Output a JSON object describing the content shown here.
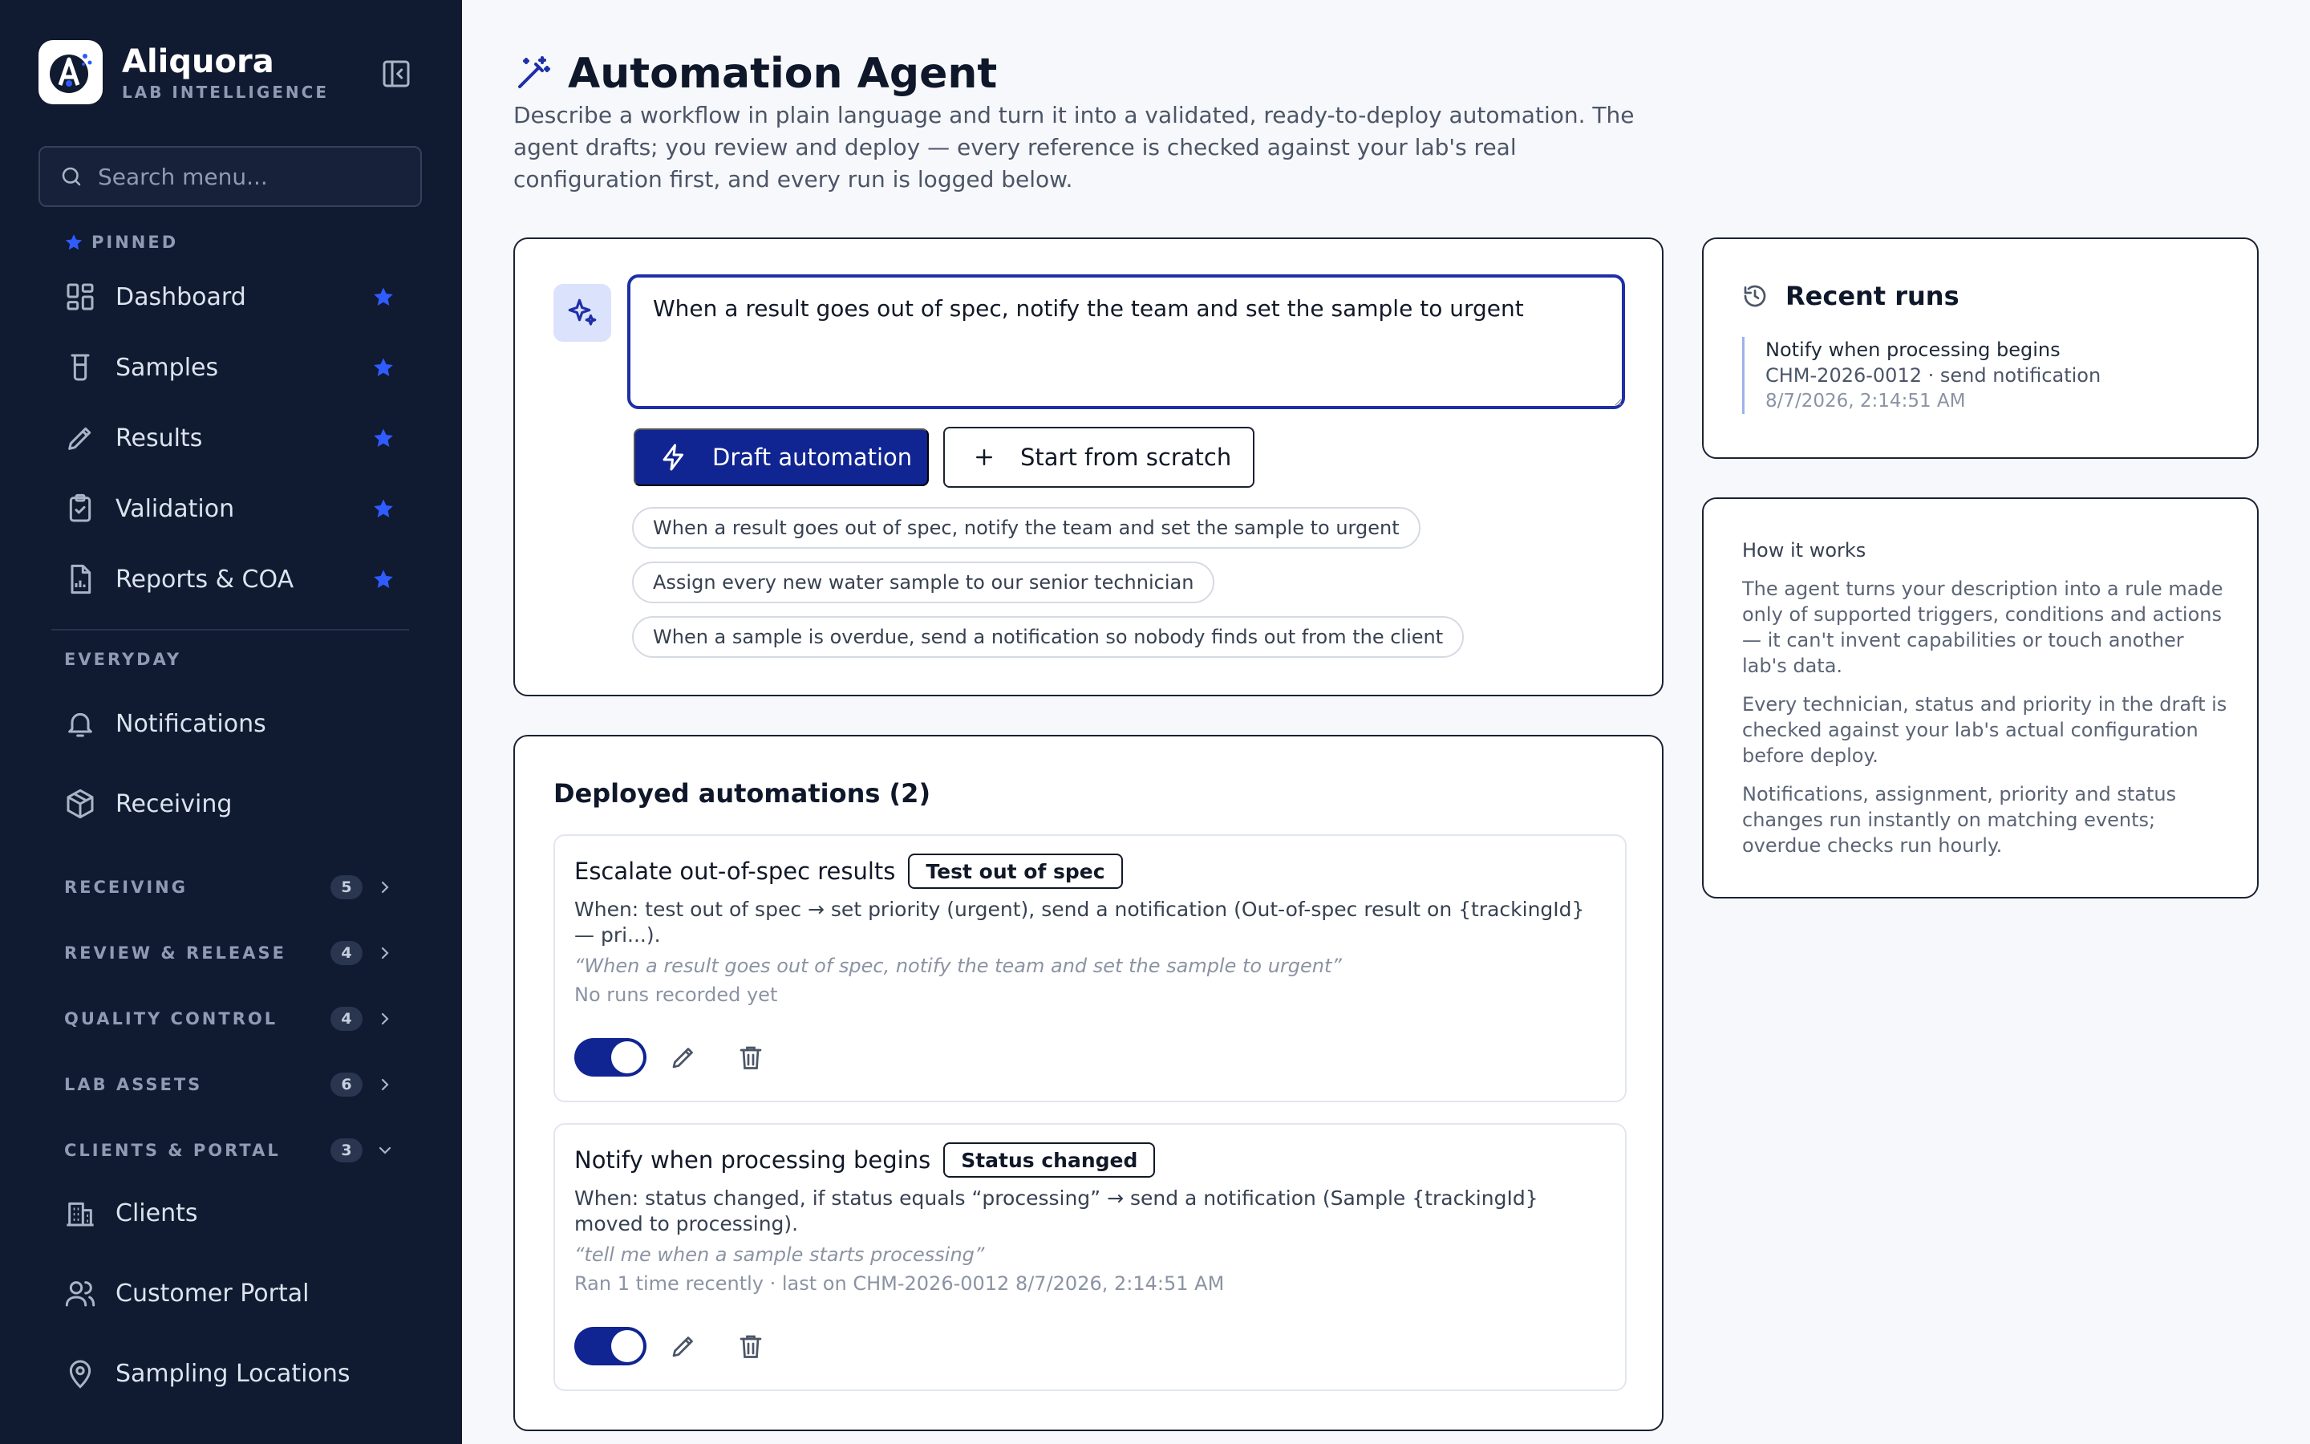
{
  "brand": {
    "name": "Aliquora",
    "subtitle": "LAB INTELLIGENCE"
  },
  "sidebar": {
    "search_placeholder": "Search menu...",
    "pinned_label": "PINNED",
    "pinned_items": [
      {
        "label": "Dashboard",
        "icon": "dashboard-icon"
      },
      {
        "label": "Samples",
        "icon": "beaker-icon"
      },
      {
        "label": "Results",
        "icon": "pencil-icon"
      },
      {
        "label": "Validation",
        "icon": "clipboard-check-icon"
      },
      {
        "label": "Reports & COA",
        "icon": "report-icon"
      }
    ],
    "everyday_label": "EVERYDAY",
    "everyday_items": [
      {
        "label": "Notifications",
        "icon": "bell-icon"
      },
      {
        "label": "Receiving",
        "icon": "package-icon"
      }
    ],
    "groups": [
      {
        "label": "RECEIVING",
        "count": "5",
        "expanded": false
      },
      {
        "label": "REVIEW & RELEASE",
        "count": "4",
        "expanded": false
      },
      {
        "label": "QUALITY CONTROL",
        "count": "4",
        "expanded": false
      },
      {
        "label": "LAB ASSETS",
        "count": "6",
        "expanded": false
      },
      {
        "label": "CLIENTS & PORTAL",
        "count": "3",
        "expanded": true
      }
    ],
    "client_items": [
      {
        "label": "Clients",
        "icon": "building-icon"
      },
      {
        "label": "Customer Portal",
        "icon": "users-icon"
      },
      {
        "label": "Sampling Locations",
        "icon": "map-pin-icon"
      }
    ]
  },
  "page": {
    "title": "Automation Agent",
    "description": "Describe a workflow in plain language and turn it into a validated, ready-to-deploy automation. The agent drafts; you review and deploy — every reference is checked against your lab's real configuration first, and every run is logged below."
  },
  "composer": {
    "prompt_value": "When a result goes out of spec, notify the team and set the sample to urgent",
    "draft_label": "Draft automation",
    "scratch_label": "Start from scratch",
    "suggestions": [
      "When a result goes out of spec, notify the team and set the sample to urgent",
      "Assign every new water sample to our senior technician",
      "When a sample is overdue, send a notification so nobody finds out from the client"
    ]
  },
  "deployed": {
    "heading": "Deployed automations (2)",
    "items": [
      {
        "name": "Escalate out-of-spec results",
        "trigger": "Test out of spec",
        "when": "When: test out of spec → set priority (urgent), send a notification (Out-of-spec result on {trackingId} — pri...).",
        "quote": "“When a result goes out of spec, notify the team and set the sample to urgent”",
        "meta": "No runs recorded yet",
        "enabled": true
      },
      {
        "name": "Notify when processing begins",
        "trigger": "Status changed",
        "when": "When: status changed, if status equals “processing” → send a notification (Sample {trackingId} moved to processing).",
        "quote": "“tell me when a sample starts processing”",
        "meta": "Ran 1 time recently · last on CHM-2026-0012 8/7/2026, 2:14:51 AM",
        "enabled": true
      }
    ]
  },
  "recent_runs": {
    "heading": "Recent runs",
    "entries": [
      {
        "title": "Notify when processing begins",
        "detail": "CHM-2026-0012 · send notification",
        "time": "8/7/2026, 2:14:51 AM"
      }
    ]
  },
  "how_it_works": {
    "heading": "How it works",
    "paragraphs": [
      "The agent turns your description into a rule made only of supported triggers, conditions and actions — it can't invent capabilities or touch another lab's data.",
      "Every technician, status and priority in the draft is checked against your lab's actual configuration before deploy.",
      "Notifications, assignment, priority and status changes run instantly on matching events; overdue checks run hourly."
    ]
  },
  "colors": {
    "sidebar_bg": "#101a30",
    "accent": "#102492",
    "star": "#2f5bff",
    "page_bg": "#f7f8fb"
  }
}
